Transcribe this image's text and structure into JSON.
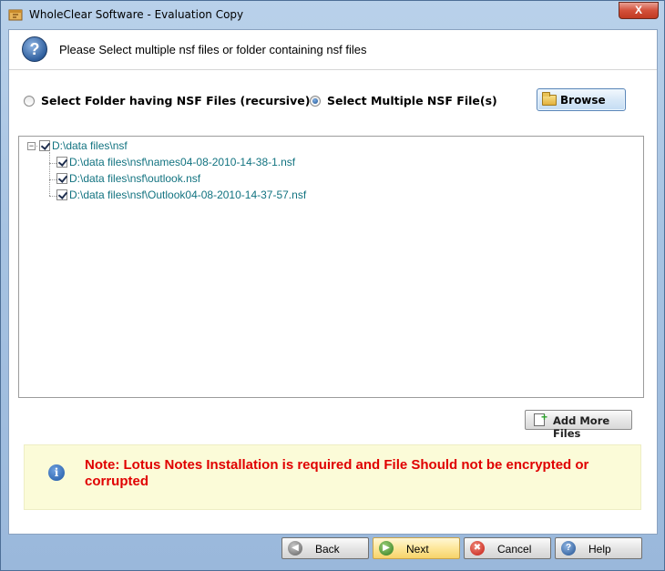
{
  "window": {
    "title": "WholeClear Software - Evaluation Copy",
    "close_label": "X",
    "app_icon": "app-icon"
  },
  "header": {
    "icon": "help-icon",
    "icon_glyph": "?",
    "text": "Please Select multiple nsf files or folder containing nsf files"
  },
  "options": {
    "folder_option_label": "Select Folder having NSF Files (recursive)",
    "multiple_option_label": "Select Multiple NSF File(s)",
    "selected": "multiple",
    "browse_label": "Browse"
  },
  "tree": {
    "root": {
      "label": "D:\\data files\\nsf",
      "checked": true,
      "expanded": true,
      "expander_glyph": "−"
    },
    "children": [
      {
        "label": "D:\\data files\\nsf\\names04-08-2010-14-38-1.nsf",
        "checked": true
      },
      {
        "label": "D:\\data files\\nsf\\outlook.nsf",
        "checked": true
      },
      {
        "label": "D:\\data files\\nsf\\Outlook04-08-2010-14-37-57.nsf",
        "checked": true
      }
    ]
  },
  "add_more_label": "Add More Files",
  "note": {
    "icon": "info-icon",
    "icon_glyph": "i",
    "text": "Note: Lotus Notes Installation is required and File Should not be encrypted or corrupted"
  },
  "buttons": {
    "back": "Back",
    "next": "Next",
    "cancel": "Cancel",
    "help": "Help"
  },
  "colors": {
    "note_text": "#e00000",
    "tree_text": "#127380",
    "note_background": "#fbfbd8"
  }
}
